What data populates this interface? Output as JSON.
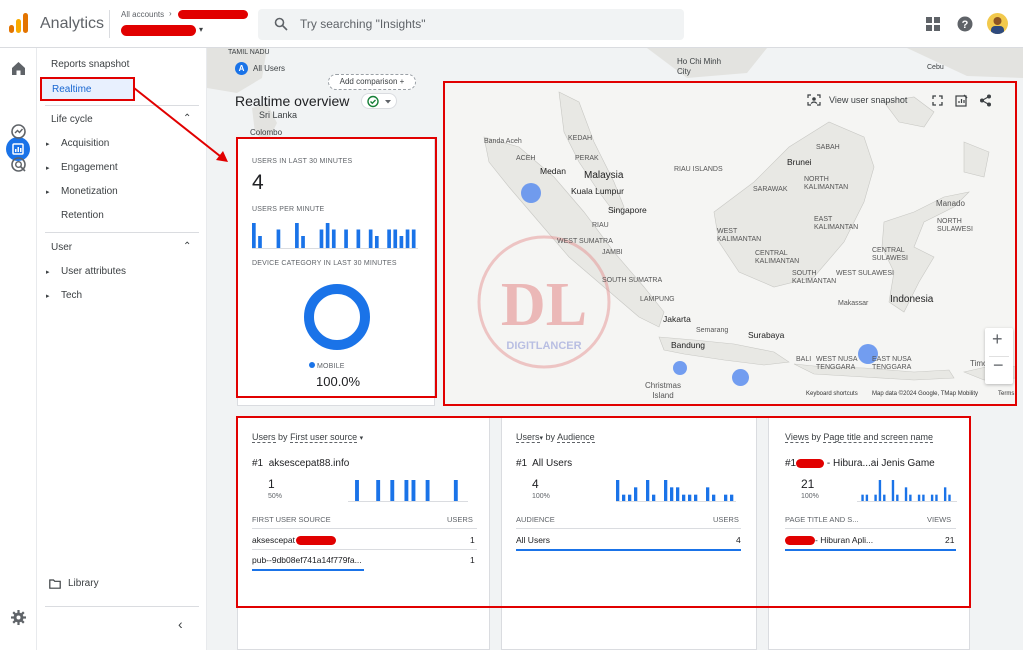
{
  "header": {
    "app_title": "Analytics",
    "accounts_label": "All accounts",
    "search_placeholder": "Try searching \"Insights\""
  },
  "nav": {
    "reports_snapshot": "Reports snapshot",
    "realtime": "Realtime",
    "lifecycle_label": "Life cycle",
    "lifecycle_items": [
      "Acquisition",
      "Engagement",
      "Monetization",
      "Retention"
    ],
    "user_label": "User",
    "user_items": [
      "User attributes",
      "Tech"
    ],
    "library": "Library"
  },
  "comparison": {
    "segment_letter": "A",
    "segment": "All Users",
    "add_comparison": "Add comparison"
  },
  "overview": {
    "title": "Realtime overview"
  },
  "background_map_labels": [
    "TAMIL NADU",
    "Sri Lanka",
    "Colombo",
    "Ho Chi Minh City",
    "Cebu"
  ],
  "summary_card": {
    "users_30_label": "USERS IN LAST 30 MINUTES",
    "users_30_value": "4",
    "upm_label": "USERS PER MINUTE",
    "upm_values": [
      4,
      2,
      0,
      0,
      3,
      0,
      0,
      4,
      2,
      0,
      0,
      3,
      4,
      3,
      0,
      3,
      0,
      3,
      0,
      3,
      2,
      0,
      3,
      3,
      2,
      3,
      3
    ],
    "device_label": "DEVICE CATEGORY IN LAST 30 MINUTES",
    "device_legend": "MOBILE",
    "device_pct": "100.0%",
    "device_share": 1.0
  },
  "map_panel": {
    "snapshot_label": "View user snapshot",
    "logo_text": "DIGITLANCER",
    "footer": [
      "Keyboard shortcuts",
      "Map data ©2024 Google, TMap Mobility",
      "Terms"
    ],
    "labels": {
      "banda_aceh": "Banda Aceh",
      "aceh": "ACEH",
      "kedah": "KEDAH",
      "perak": "PERAK",
      "medan": "Medan",
      "malaysia": "Malaysia",
      "kuala_lumpur": "Kuala Lumpur",
      "riau_islands": "RIAU ISLANDS",
      "singapore": "Singapore",
      "riau": "RIAU",
      "west_sumatra": "WEST SUMATRA",
      "jambi": "JAMBI",
      "south_sumatra": "SOUTH SUMATRA",
      "lampung": "LAMPUNG",
      "jakarta": "Jakarta",
      "bandung": "Bandung",
      "semarang": "Semarang",
      "surabaya": "Surabaya",
      "christmas_island": "Christmas Island",
      "brunei": "Brunei",
      "sabah": "SABAH",
      "north_kalimantan": "NORTH KALIMANTAN",
      "sarawak": "SARAWAK",
      "west_kalimantan": "WEST KALIMANTAN",
      "east_kalimantan": "EAST KALIMANTAN",
      "central_kalimantan": "CENTRAL KALIMANTAN",
      "south_kalimantan": "SOUTH KALIMANTAN",
      "manado": "Manado",
      "north_sulawesi": "NORTH SULAWESI",
      "central_sulawesi": "CENTRAL SULAWESI",
      "west_sulawesi": "WEST SULAWESI",
      "makassar": "Makassar",
      "indonesia": "Indonesia",
      "bali": "BALI",
      "west_nusa": "WEST NUSA TENGGARA",
      "east_nusa": "EAST NUSA TENGGARA",
      "timor_leste": "Timor-Leste"
    }
  },
  "cards": [
    {
      "title_main": "Users",
      "title_by": "by",
      "title_dim": "First user source",
      "top_rank": "#1",
      "top_name": "aksescepat88.info",
      "top_value": "1",
      "top_pct": "50%",
      "col_left": "FIRST USER SOURCE",
      "col_right": "USERS",
      "rows": [
        {
          "name": "aksescepat",
          "value": "1"
        },
        {
          "name": "pub--9db08ef741a14f779fa...",
          "value": "1"
        }
      ],
      "spark": [
        0,
        3,
        0,
        0,
        3,
        0,
        3,
        0,
        3,
        3,
        0,
        3,
        0,
        0,
        0,
        3,
        0
      ]
    },
    {
      "title_main": "Users",
      "title_by": "by",
      "title_dim": "Audience",
      "top_rank": "#1",
      "top_name": "All Users",
      "top_value": "4",
      "top_pct": "100%",
      "col_left": "AUDIENCE",
      "col_right": "USERS",
      "rows": [
        {
          "name": "All Users",
          "value": "4"
        }
      ],
      "spark": [
        3,
        1,
        1,
        2,
        0,
        3,
        1,
        0,
        3,
        2,
        2,
        1,
        1,
        1,
        0,
        2,
        1,
        0,
        1,
        1
      ]
    },
    {
      "title_main": "Views",
      "title_by": "by",
      "title_dim": "Page title and screen name",
      "top_rank": "#1",
      "top_name": "- Hibura...ai Jenis Game",
      "top_value": "21",
      "top_pct": "100%",
      "col_left": "PAGE TITLE AND S...",
      "col_right": "VIEWS",
      "rows": [
        {
          "name": "- Hiburan Apli...",
          "value": "21"
        }
      ],
      "spark": [
        0,
        1,
        1,
        0,
        1,
        3,
        1,
        0,
        3,
        1,
        0,
        2,
        1,
        0,
        1,
        1,
        0,
        1,
        1,
        0,
        2,
        1,
        0
      ]
    }
  ],
  "colors": {
    "accent": "#1a73e8",
    "annotation_red": "#e10000",
    "map_dot": "#5b8def"
  }
}
